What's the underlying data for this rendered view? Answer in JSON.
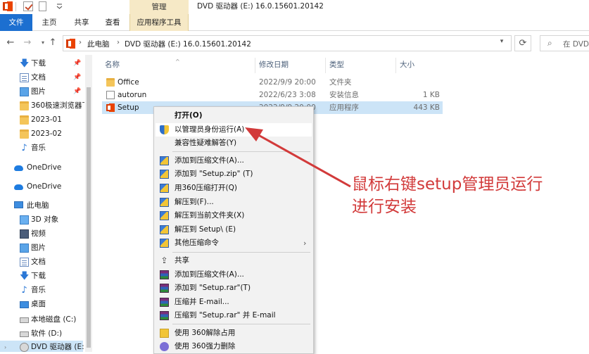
{
  "titlebar": {
    "context_group": "管理",
    "window_title": "DVD 驱动器 (E:) 16.0.15601.20142"
  },
  "ribbon": {
    "tabs": [
      {
        "label": "文件"
      },
      {
        "label": "主页"
      },
      {
        "label": "共享"
      },
      {
        "label": "查看"
      },
      {
        "label": "应用程序工具"
      }
    ]
  },
  "address": {
    "path": [
      "此电脑",
      "DVD 驱动器 (E:) 16.0.15601.20142"
    ],
    "search_placeholder": "在 DVD"
  },
  "navpane": {
    "items": [
      {
        "label": "下载",
        "icon": "download-icon",
        "pinned": true
      },
      {
        "label": "文档",
        "icon": "document-icon",
        "pinned": true
      },
      {
        "label": "图片",
        "icon": "picture-icon",
        "pinned": true
      },
      {
        "label": "360极速浏览器下",
        "icon": "folder-icon",
        "pinned": false
      },
      {
        "label": "2023-01",
        "icon": "folder-icon",
        "pinned": false
      },
      {
        "label": "2023-02",
        "icon": "folder-icon",
        "pinned": false
      },
      {
        "label": "音乐",
        "icon": "music-icon",
        "pinned": false
      },
      {
        "label": "OneDrive",
        "icon": "onedrive-icon",
        "pinned": false
      },
      {
        "label": "OneDrive",
        "icon": "onedrive-icon",
        "pinned": false
      },
      {
        "label": "此电脑",
        "icon": "computer-icon",
        "pinned": false
      },
      {
        "label": "3D 对象",
        "icon": "3d-objects-icon",
        "pinned": false
      },
      {
        "label": "视频",
        "icon": "video-icon",
        "pinned": false
      },
      {
        "label": "图片",
        "icon": "picture-icon",
        "pinned": false
      },
      {
        "label": "文档",
        "icon": "document-icon",
        "pinned": false
      },
      {
        "label": "下载",
        "icon": "download-icon",
        "pinned": false
      },
      {
        "label": "音乐",
        "icon": "music-icon",
        "pinned": false
      },
      {
        "label": "桌面",
        "icon": "desktop-icon",
        "pinned": false
      },
      {
        "label": "本地磁盘 (C:)",
        "icon": "drive-icon",
        "pinned": false
      },
      {
        "label": "软件 (D:)",
        "icon": "drive-icon",
        "pinned": false
      },
      {
        "label": "DVD 驱动器 (E:",
        "icon": "dvd-drive-icon",
        "pinned": false
      }
    ]
  },
  "columns": {
    "name": "名称",
    "date": "修改日期",
    "type": "类型",
    "size": "大小"
  },
  "files": [
    {
      "name": "Office",
      "date": "2022/9/9 20:00",
      "type": "文件夹",
      "size": "",
      "icon": "folder-icon"
    },
    {
      "name": "autorun",
      "date": "2022/6/23 3:08",
      "type": "安装信息",
      "size": "1 KB",
      "icon": "file-icon"
    },
    {
      "name": "Setup",
      "date": "2022/9/9 20:00",
      "type": "应用程序",
      "size": "443 KB",
      "icon": "setup-icon"
    }
  ],
  "context_menu": {
    "items": [
      {
        "label": "打开(O)",
        "bold": true
      },
      {
        "label": "以管理员身份运行(A)",
        "icon": "shield-icon"
      },
      {
        "label": "兼容性疑难解答(Y)"
      },
      {
        "label": "添加到压缩文件(A)...",
        "icon": "zip-icon"
      },
      {
        "label": "添加到 \"Setup.zip\" (T)",
        "icon": "zip-icon"
      },
      {
        "label": "用360压缩打开(Q)",
        "icon": "zip-icon"
      },
      {
        "label": "解压到(F)...",
        "icon": "zip-icon"
      },
      {
        "label": "解压到当前文件夹(X)",
        "icon": "zip-icon"
      },
      {
        "label": "解压到 Setup\\ (E)",
        "icon": "zip-icon"
      },
      {
        "label": "其他压缩命令",
        "icon": "zip-icon",
        "submenu": true
      },
      {
        "label": "共享",
        "icon": "share-icon"
      },
      {
        "label": "添加到压缩文件(A)...",
        "icon": "winrar-icon"
      },
      {
        "label": "添加到 \"Setup.rar\"(T)",
        "icon": "winrar-icon"
      },
      {
        "label": "压缩并 E-mail...",
        "icon": "winrar-icon"
      },
      {
        "label": "压缩到 \"Setup.rar\" 并 E-mail",
        "icon": "winrar-icon"
      },
      {
        "label": "使用 360解除占用",
        "icon": "360-unlock-icon"
      },
      {
        "label": "使用 360强力删除",
        "icon": "360-delete-icon"
      }
    ]
  },
  "annotation": {
    "line1": "鼠标右键setup管理员运行",
    "line2": "进行安装",
    "color": "#d23a3a"
  }
}
